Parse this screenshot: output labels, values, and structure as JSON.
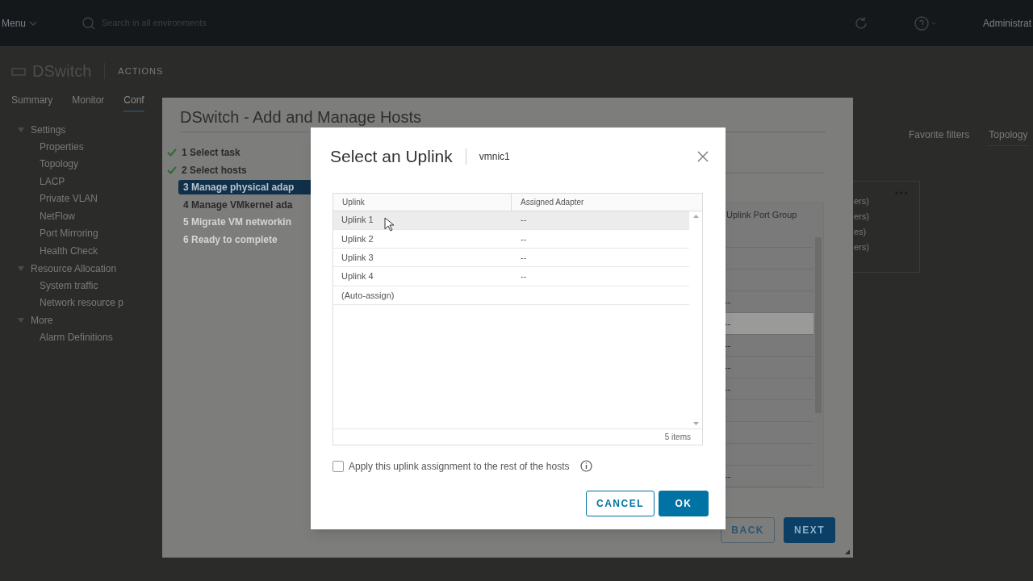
{
  "top_bar": {
    "menu": "Menu",
    "search": {
      "placeholder": "Search in all environments"
    },
    "user": "Administrat"
  },
  "object": {
    "title": "DSwitch",
    "actions": "ACTIONS"
  },
  "tabs": [
    {
      "label": "Summary",
      "selected": false
    },
    {
      "label": "Monitor",
      "selected": false
    },
    {
      "label": "Conf",
      "selected": true
    }
  ],
  "sidebar": {
    "items": [
      {
        "label": "Settings",
        "expanded": true,
        "children": [
          {
            "label": "Properties"
          },
          {
            "label": "Topology"
          },
          {
            "label": "LACP"
          },
          {
            "label": "Private VLAN"
          },
          {
            "label": "NetFlow"
          },
          {
            "label": "Port Mirroring"
          },
          {
            "label": "Health Check"
          }
        ]
      },
      {
        "label": "Resource Allocation",
        "expanded": true,
        "children": [
          {
            "label": "System traffic"
          },
          {
            "label": "Network resource p"
          }
        ]
      },
      {
        "label": "More",
        "expanded": true,
        "children": [
          {
            "label": "Alarm Definitions"
          }
        ]
      }
    ]
  },
  "right_panel": {
    "filters": "Favorite filters",
    "view": "Topology",
    "card_lines": [
      "ers)",
      "ers)",
      "es)",
      "ers)"
    ]
  },
  "wizard": {
    "title": "DSwitch - Add and Manage Hosts",
    "steps": [
      {
        "label": "1 Select task",
        "done": true,
        "selected": false,
        "disabled": false
      },
      {
        "label": "2 Select hosts",
        "done": true,
        "selected": false,
        "disabled": false
      },
      {
        "label": "3 Manage physical adap",
        "done": false,
        "selected": true,
        "disabled": false
      },
      {
        "label": "4 Manage VMkernel ada",
        "done": false,
        "selected": false,
        "disabled": false
      },
      {
        "label": "5 Migrate VM networkin",
        "done": false,
        "selected": false,
        "disabled": true
      },
      {
        "label": "6 Ready to complete",
        "done": false,
        "selected": false,
        "disabled": true
      }
    ],
    "table": {
      "columns": [
        "Uplink Port Group"
      ],
      "rows": [
        {
          "selected": false
        },
        {
          "selected": false
        },
        {
          "selected": false
        },
        {
          "selected": false,
          "value": "--"
        },
        {
          "selected": true,
          "value": "--"
        },
        {
          "selected": false,
          "value": "--"
        },
        {
          "selected": false,
          "value": "--"
        },
        {
          "selected": false,
          "value": "--"
        },
        {
          "selected": false
        },
        {
          "selected": false
        },
        {
          "selected": false
        },
        {
          "selected": false,
          "value": "--"
        }
      ]
    },
    "buttons": [
      {
        "label": "BACK",
        "kind": "secondary"
      },
      {
        "label": "NEXT",
        "kind": "primary"
      }
    ]
  },
  "dialog": {
    "title": "Select an Uplink",
    "subtitle": "vmnic1",
    "columns": [
      "Uplink",
      "Assigned Adapter"
    ],
    "rows": [
      {
        "uplink": "Uplink 1",
        "adapter": "--",
        "selected": true
      },
      {
        "uplink": "Uplink 2",
        "adapter": "--",
        "selected": false
      },
      {
        "uplink": "Uplink 3",
        "adapter": "--",
        "selected": false
      },
      {
        "uplink": "Uplink 4",
        "adapter": "--",
        "selected": false
      },
      {
        "uplink": "(Auto-assign)",
        "selected": false
      }
    ],
    "footer": "5 items",
    "option": {
      "label": "Apply this uplink assignment to the rest of the hosts",
      "checked": false
    },
    "buttons": [
      {
        "label": "CANCEL",
        "kind": "secondary"
      },
      {
        "label": "OK",
        "kind": "primary"
      }
    ]
  }
}
